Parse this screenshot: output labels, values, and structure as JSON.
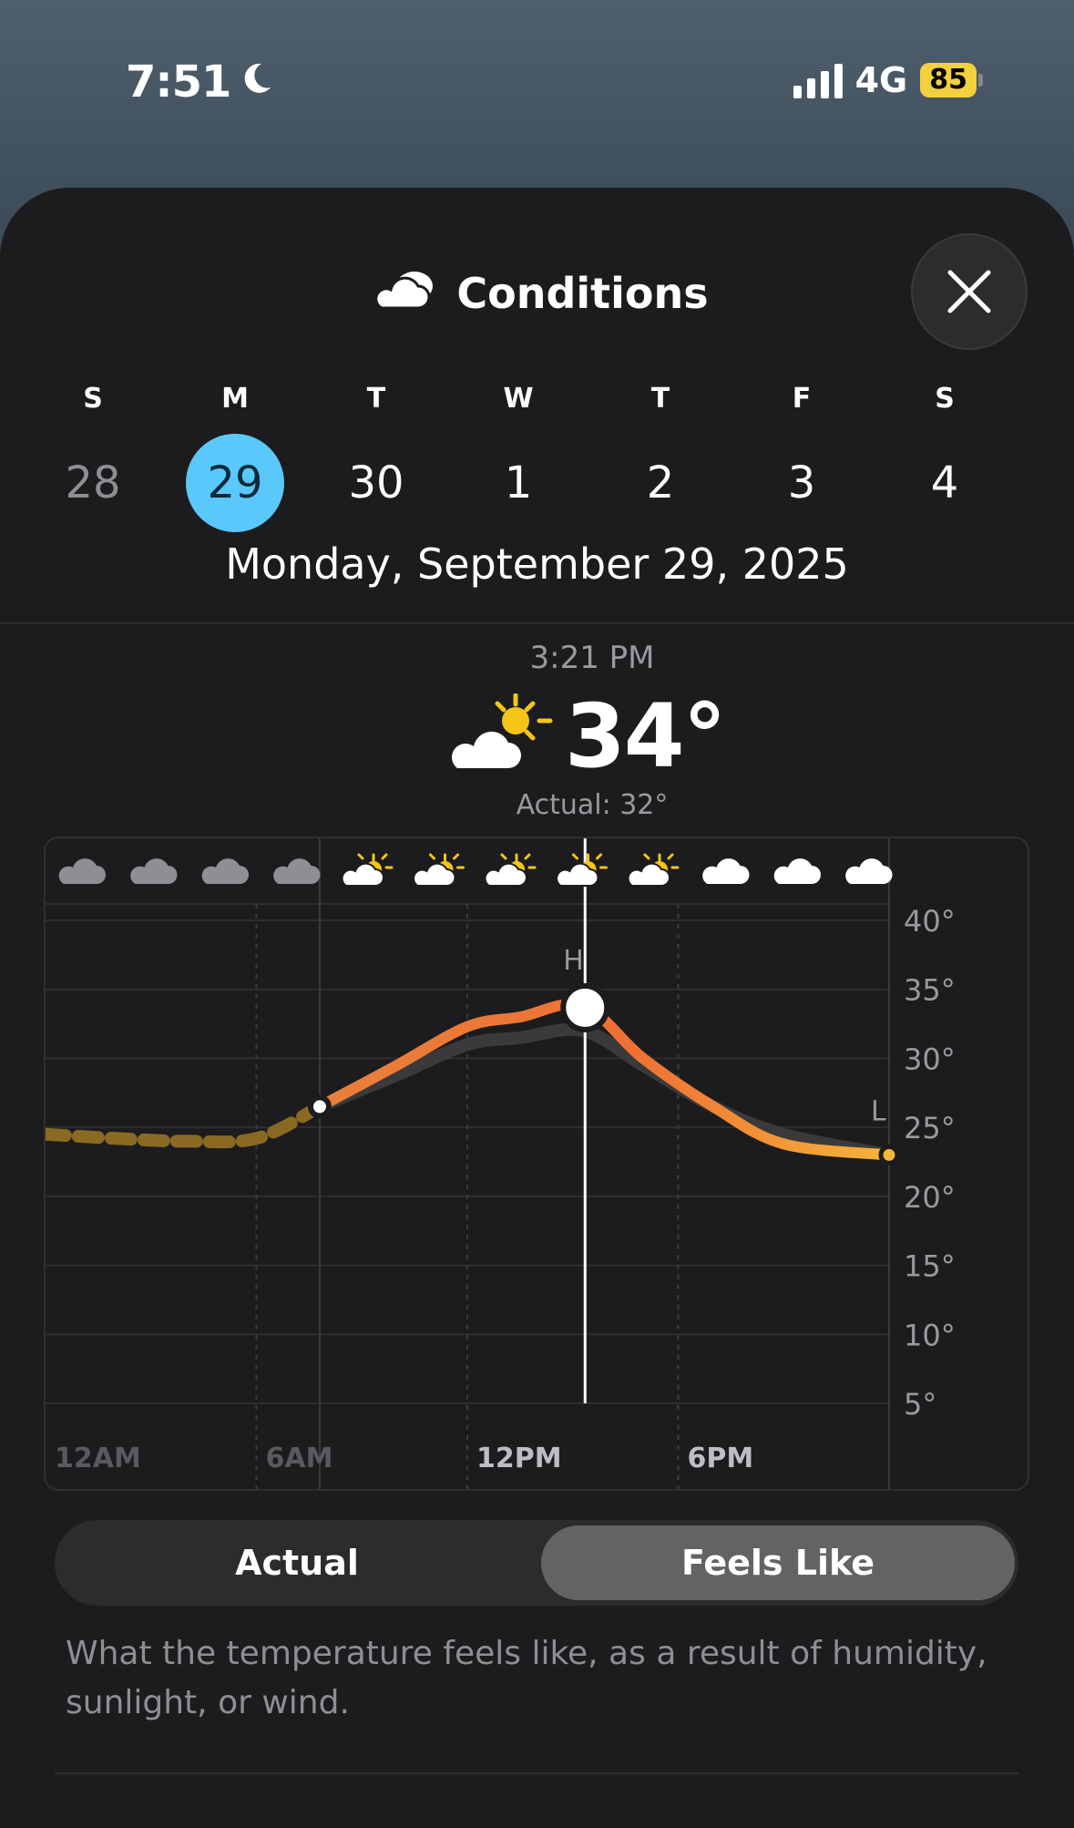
{
  "status_bar": {
    "time": "7:51",
    "network": "4G",
    "battery": "85",
    "moon_icon": "moon-icon",
    "signal_icon": "signal-bars-icon"
  },
  "header": {
    "title": "Conditions",
    "icon": "cloud-icon",
    "close_icon": "close-icon"
  },
  "week": {
    "days": [
      {
        "weekday": "S",
        "num": "28",
        "state": "past"
      },
      {
        "weekday": "M",
        "num": "29",
        "state": "selected"
      },
      {
        "weekday": "T",
        "num": "30",
        "state": "future"
      },
      {
        "weekday": "W",
        "num": "1",
        "state": "future"
      },
      {
        "weekday": "T",
        "num": "2",
        "state": "future"
      },
      {
        "weekday": "F",
        "num": "3",
        "state": "future"
      },
      {
        "weekday": "S",
        "num": "4",
        "state": "future"
      }
    ],
    "selected_date": "Monday, September 29, 2025"
  },
  "current": {
    "time": "3:21 PM",
    "temp": "34°",
    "actual": "Actual: 32°",
    "icon": "partly-sunny-icon"
  },
  "chart_data": {
    "type": "line",
    "x_ticks": [
      "12AM",
      "6AM",
      "12PM",
      "6PM"
    ],
    "y_ticks": [
      "40°",
      "35°",
      "30°",
      "25°",
      "20°",
      "15°",
      "10°",
      "5°"
    ],
    "ylim": [
      5,
      40
    ],
    "xlim": [
      0,
      24
    ],
    "high_label": "H",
    "low_label": "L",
    "current_hour": 15.35,
    "series": [
      {
        "name": "Feels Like",
        "x": [
          0,
          2,
          4,
          6,
          7.8,
          10,
          12,
          13.5,
          15.3,
          17,
          19,
          21,
          24
        ],
        "y": [
          24.5,
          24.2,
          24,
          24.2,
          26.5,
          29.5,
          32.3,
          33,
          33.8,
          30,
          26.5,
          23.8,
          23
        ]
      },
      {
        "name": "Actual",
        "x": [
          7.8,
          10,
          12,
          13.5,
          15.3,
          17,
          19,
          21,
          24
        ],
        "y": [
          26.5,
          28.8,
          31,
          31.5,
          32,
          29.5,
          26.5,
          24.5,
          23
        ]
      }
    ],
    "condition_icons": [
      "cloud-icon",
      "cloud-icon",
      "cloud-icon",
      "cloud-icon",
      "partly-sunny-icon",
      "partly-sunny-icon",
      "partly-sunny-icon",
      "partly-sunny-icon",
      "partly-sunny-icon",
      "cloud-icon",
      "cloud-icon",
      "cloud-icon"
    ]
  },
  "toggle": {
    "options": [
      "Actual",
      "Feels Like"
    ],
    "selected": "Feels Like"
  },
  "description": "What the temperature feels like, as a result of humidity, sunlight, or wind."
}
